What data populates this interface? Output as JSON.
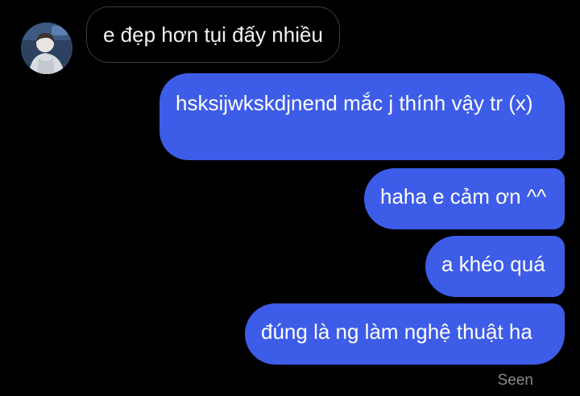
{
  "conversation": {
    "incoming": {
      "text": "e đẹp hơn tụi đấy nhiều"
    },
    "outgoing": [
      {
        "text": "hsksijwkskdjnend mắc j thính vậy tr (x)"
      },
      {
        "text": "haha e cảm ơn ^^"
      },
      {
        "text": "a khéo quá"
      },
      {
        "text": "đúng là ng làm nghệ thuật ha"
      }
    ],
    "status": "Seen"
  },
  "colors": {
    "background": "#000000",
    "outgoing_bubble": "#3d5ce8",
    "incoming_border": "#3c3c3c",
    "seen_text": "#8a8a8a"
  }
}
